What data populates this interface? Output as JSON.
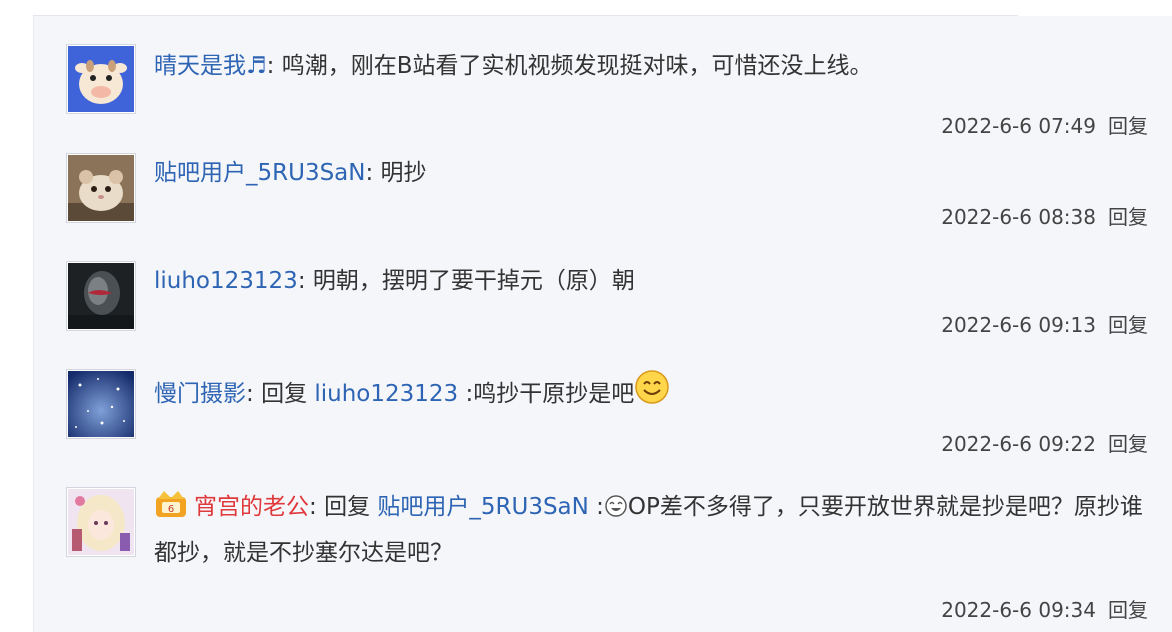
{
  "replies": [
    {
      "username": "晴天是我♬",
      "colon": ": ",
      "text": "鸣潮，刚在B站看了实机视频发现挺对味，可惜还没上线。",
      "time": "2022-6-6 07:49",
      "reply_label": "回复"
    },
    {
      "username": "贴吧用户_5RU3SaN",
      "colon": ": ",
      "text": "明抄",
      "time": "2022-6-6 08:38",
      "reply_label": "回复"
    },
    {
      "username": "liuho123123",
      "colon": ": ",
      "text": "明朝，摆明了要干掉元（原）朝",
      "time": "2022-6-6 09:13",
      "reply_label": "回复"
    },
    {
      "username": "慢门摄影",
      "colon": ": ",
      "reply_word": "回复 ",
      "at_user": "liuho123123",
      "text": " :鸣抄干原抄是吧",
      "time": "2022-6-6 09:22",
      "reply_label": "回复"
    },
    {
      "username": "宵宫的老公",
      "colon": ": ",
      "reply_word": "回复 ",
      "at_user": "贴吧用户_5RU3SaN",
      "text_prefix": " :",
      "text": "OP差不多得了，只要开放世界就是抄是吧？原抄谁都抄，就是不抄塞尔达是吧？",
      "time": "2022-6-6 09:34",
      "reply_label": "回复"
    }
  ],
  "colors": {
    "username_blue": "#2d64b3",
    "vip_red": "#e0393b",
    "panel_bg": "#f5f6fa"
  },
  "icons": {
    "avatar1": "cartoon-cow-avatar",
    "avatar2": "hamster-avatar",
    "avatar3": "dark-figure-avatar",
    "avatar4": "starry-sky-avatar",
    "avatar5": "anime-girl-avatar",
    "emoji4": "smile-emoji",
    "emoji5": "laugh-cry-emoji",
    "vip": "crown-vip-badge"
  }
}
